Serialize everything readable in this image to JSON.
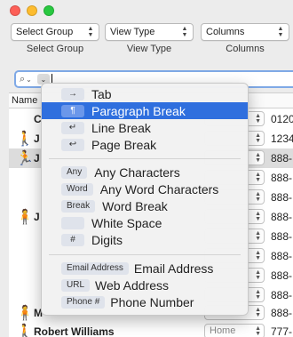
{
  "colors": {
    "close": "#fd5f57",
    "minimize": "#fdbc2e",
    "zoom": "#28c840",
    "selection": "#2f6fde"
  },
  "toolbar": {
    "items": [
      {
        "value": "Select Group",
        "label": "Select Group"
      },
      {
        "value": "View Type",
        "label": "View Type"
      },
      {
        "value": "Columns",
        "label": "Columns"
      }
    ]
  },
  "search": {
    "icon": "magnifier-icon",
    "insert_symbol": "⌄"
  },
  "table": {
    "header_fragment": "Name",
    "rows": [
      {
        "name": "C",
        "phone": "0120",
        "sel": "",
        "figure": ""
      },
      {
        "name": "J",
        "phone": "1234",
        "sel": "",
        "figure": "walking-figure"
      },
      {
        "name": "J",
        "phone": "888-",
        "sel": "",
        "figure": "running-figure"
      },
      {
        "name": "",
        "phone": "888-",
        "sel": "",
        "figure": ""
      },
      {
        "name": "",
        "phone": "888-",
        "sel": "",
        "figure": ""
      },
      {
        "name": "J",
        "phone": "888-",
        "sel": "",
        "figure": "standing-figure"
      },
      {
        "name": "",
        "phone": "888-",
        "sel": "",
        "figure": ""
      },
      {
        "name": "",
        "phone": "888-",
        "sel": "",
        "figure": ""
      },
      {
        "name": "",
        "phone": "888-",
        "sel": "",
        "figure": ""
      },
      {
        "name": "",
        "phone": "888-",
        "sel": "",
        "figure": ""
      },
      {
        "name": "M",
        "phone": "888-",
        "sel": "",
        "figure": "standing-figure"
      },
      {
        "name": "Robert Williams",
        "phone": "777-",
        "sel": "Home",
        "figure": "walking-figure"
      }
    ]
  },
  "menu": {
    "group1": [
      {
        "token": "→",
        "label": "Tab"
      },
      {
        "token": "¶",
        "label": "Paragraph Break",
        "selected": true
      },
      {
        "token": "↵",
        "label": "Line Break"
      },
      {
        "token": "↩",
        "label": "Page Break"
      }
    ],
    "group2": [
      {
        "token": "Any",
        "label": "Any Characters"
      },
      {
        "token": "Word",
        "label": "Any Word Characters"
      },
      {
        "token": "Break",
        "label": "Word Break"
      },
      {
        "token": "",
        "label": "White Space"
      },
      {
        "token": "#",
        "label": "Digits"
      }
    ],
    "group3": [
      {
        "token": "Email Address",
        "label": "Email Address"
      },
      {
        "token": "URL",
        "label": "Web Address"
      },
      {
        "token": "Phone #",
        "label": "Phone Number"
      }
    ]
  }
}
